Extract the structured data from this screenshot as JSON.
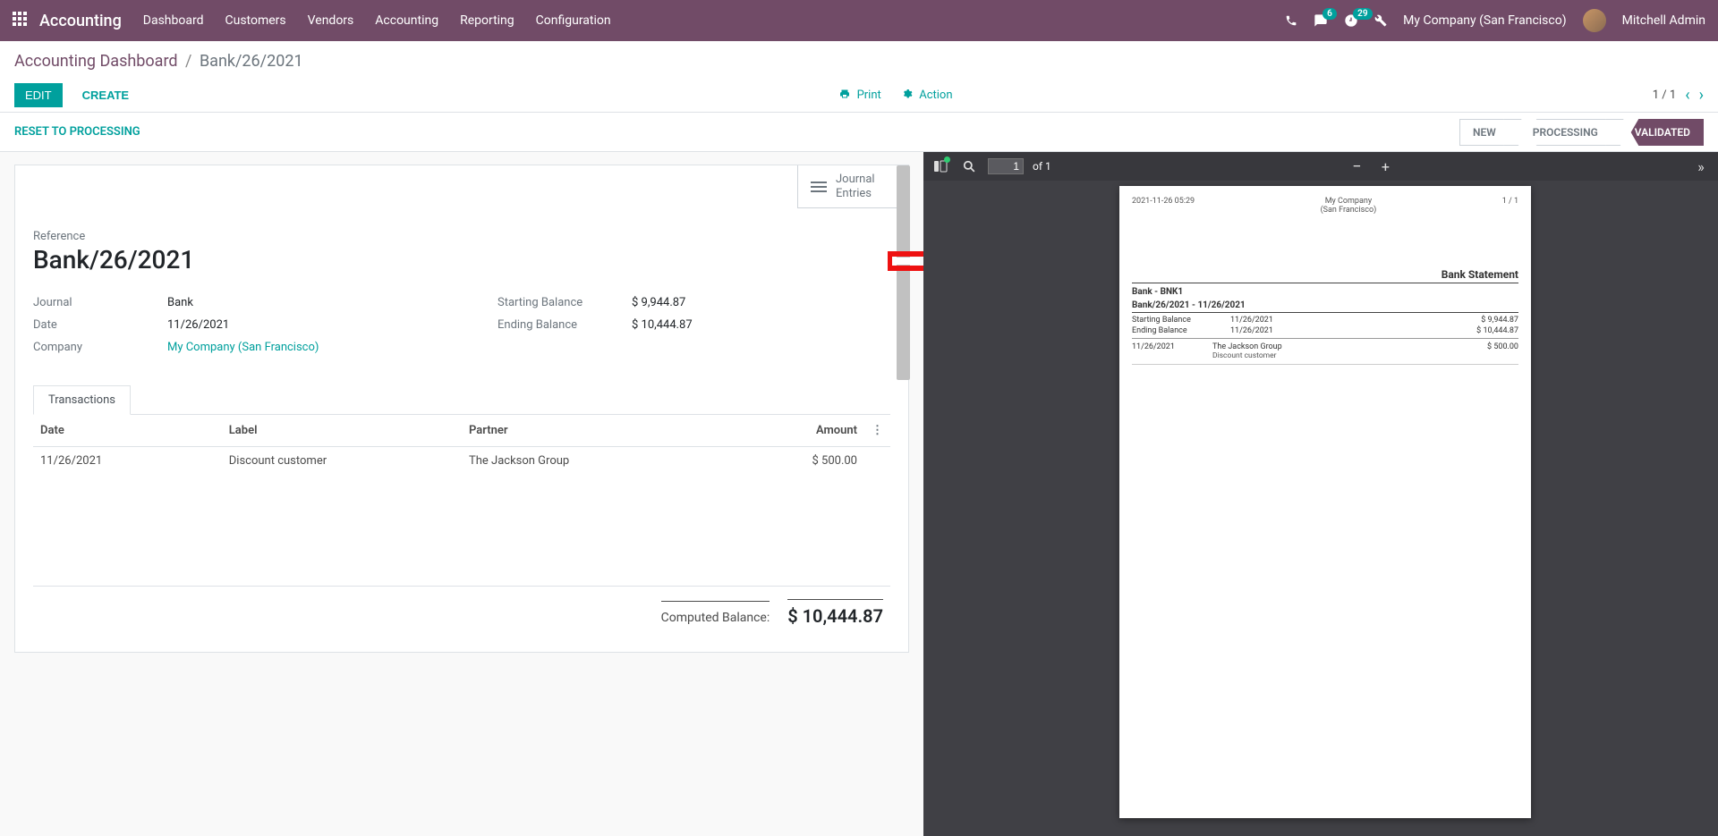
{
  "navbar": {
    "brand": "Accounting",
    "menu": [
      "Dashboard",
      "Customers",
      "Vendors",
      "Accounting",
      "Reporting",
      "Configuration"
    ],
    "messages_badge": "6",
    "activities_badge": "29",
    "company": "My Company (San Francisco)",
    "user": "Mitchell Admin"
  },
  "breadcrumb": {
    "parent": "Accounting Dashboard",
    "current": "Bank/26/2021"
  },
  "cp": {
    "edit": "EDIT",
    "create": "CREATE",
    "print": "Print",
    "action": "Action",
    "pager": "1 / 1"
  },
  "statusbar": {
    "reset": "RESET TO PROCESSING",
    "stages": [
      "NEW",
      "PROCESSING",
      "VALIDATED"
    ]
  },
  "buttonbox": {
    "journal_entries": "Journal\nEntries"
  },
  "form": {
    "ref_label": "Reference",
    "ref_value": "Bank/26/2021",
    "left": [
      {
        "label": "Journal",
        "value": "Bank",
        "link": false
      },
      {
        "label": "Date",
        "value": "11/26/2021",
        "link": false
      },
      {
        "label": "Company",
        "value": "My Company (San Francisco)",
        "link": true
      }
    ],
    "right": [
      {
        "label": "Starting Balance",
        "value": "$ 9,944.87"
      },
      {
        "label": "Ending Balance",
        "value": "$ 10,444.87"
      }
    ]
  },
  "tabs": {
    "transactions": "Transactions"
  },
  "tx_table": {
    "headers": {
      "date": "Date",
      "label": "Label",
      "partner": "Partner",
      "amount": "Amount"
    },
    "rows": [
      {
        "date": "11/26/2021",
        "label": "Discount customer",
        "partner": "The Jackson Group",
        "amount": "$ 500.00"
      }
    ],
    "computed_label": "Computed Balance:",
    "computed_value": "$ 10,444.87"
  },
  "pdf": {
    "toolbar": {
      "page_input": "1",
      "of": "of 1"
    },
    "header_date": "2021-11-26 05:29",
    "header_company_l1": "My Company",
    "header_company_l2": "(San Francisco)",
    "header_pages": "1   /   1",
    "title": "Bank Statement",
    "sub1": "Bank - BNK1",
    "sub2": "Bank/26/2021 - 11/26/2021",
    "bal": [
      {
        "label": "Starting Balance",
        "date": "11/26/2021",
        "amount": "$ 9,944.87"
      },
      {
        "label": "Ending Balance",
        "date": "11/26/2021",
        "amount": "$ 10,444.87"
      }
    ],
    "tx": [
      {
        "date": "11/26/2021",
        "partner": "The Jackson Group",
        "desc": "Discount customer",
        "amount": "$ 500.00"
      }
    ]
  }
}
